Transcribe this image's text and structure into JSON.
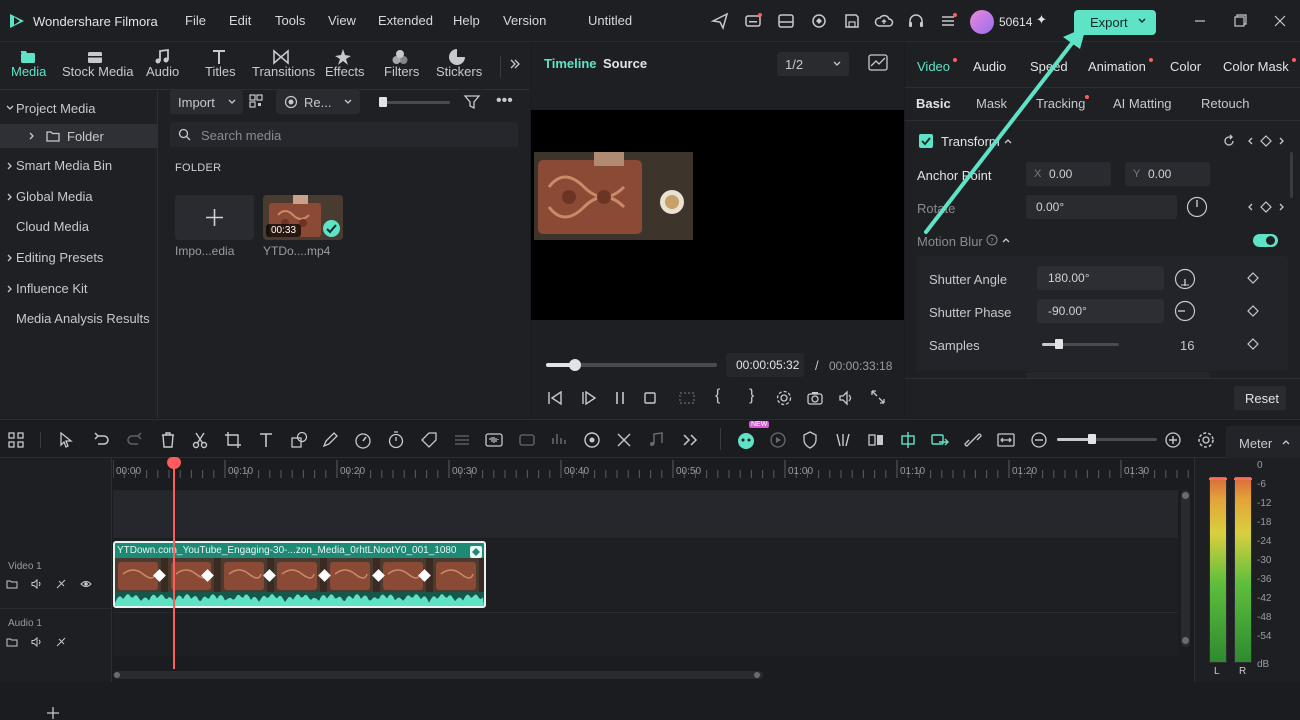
{
  "app": {
    "name": "Wondershare Filmora",
    "project_title": "Untitled",
    "credits": "50614",
    "export_label": "Export"
  },
  "menu": [
    "File",
    "Edit",
    "Tools",
    "View",
    "Extended",
    "Help",
    "Version"
  ],
  "media_tabs": [
    "Media",
    "Stock Media",
    "Audio",
    "Titles",
    "Transitions",
    "Effects",
    "Filters",
    "Stickers"
  ],
  "project_tree": {
    "project_media": "Project Media",
    "folder": "Folder",
    "items": [
      "Smart Media Bin",
      "Global Media",
      "Cloud Media",
      "Editing Presets",
      "Influence Kit",
      "Media Analysis Results"
    ]
  },
  "media_toolbar": {
    "import_label": "Import",
    "sort_label": "Re...",
    "search_placeholder": "Search media"
  },
  "folder_section": {
    "heading": "FOLDER",
    "import_tile_label": "Impo...edia",
    "clip_name": "YTDo....mp4",
    "clip_duration": "00:33"
  },
  "preview": {
    "tab_timeline": "Timeline",
    "tab_source": "Source",
    "quality": "1/2",
    "current_time": "00:00:05:32",
    "separator": "/",
    "total_time": "00:00:33:18",
    "progress": 0.17
  },
  "properties": {
    "tabs": [
      "Video",
      "Audio",
      "Speed",
      "Animation",
      "Color",
      "Color Mask"
    ],
    "subtabs": [
      "Basic",
      "Mask",
      "Tracking",
      "AI Matting",
      "Retouch"
    ],
    "transform_label": "Transform",
    "anchor_label": "Anchor Point",
    "anchor_x_prefix": "X",
    "anchor_x": "0.00",
    "anchor_y_prefix": "Y",
    "anchor_y": "0.00",
    "rotate_label": "Rotate",
    "rotate_value": "0.00°",
    "motion_blur_label": "Motion Blur",
    "shutter_angle_label": "Shutter Angle",
    "shutter_angle": "180.00°",
    "shutter_phase_label": "Shutter Phase",
    "shutter_phase": "-90.00°",
    "samples_label": "Samples",
    "samples": "16",
    "samples_level": 0.22,
    "reset_label": "Reset"
  },
  "timeline": {
    "ruler": [
      "00:00",
      "00:10",
      "00:20",
      "00:30",
      "00:40",
      "00:50",
      "01:00",
      "01:10",
      "01:20",
      "01:30"
    ],
    "video_track": "Video 1",
    "audio_track": "Audio 1",
    "clip_label": "YTDown.com_YouTube_Engaging-30-...zon_Media_0rhtLNootY0_001_1080p",
    "meter_label": "Meter",
    "meter_scale": [
      "0",
      "-6",
      "-12",
      "-18",
      "-24",
      "-30",
      "-36",
      "-42",
      "-48",
      "-54",
      "dB"
    ],
    "meter_l": "L",
    "meter_r": "R",
    "new_badge": "NEW"
  },
  "colors": {
    "accent": "#5fe3c7",
    "playhead": "#ff5c5c",
    "clip": "#1d8a76"
  }
}
